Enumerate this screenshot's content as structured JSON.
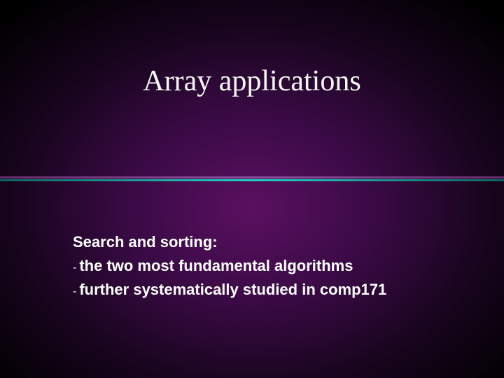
{
  "slide": {
    "title": "Array applications",
    "body": {
      "heading": "Search and sorting:",
      "dash": "-",
      "items": [
        "the two most fundamental algorithms",
        "further systematically studied in comp171"
      ]
    }
  }
}
